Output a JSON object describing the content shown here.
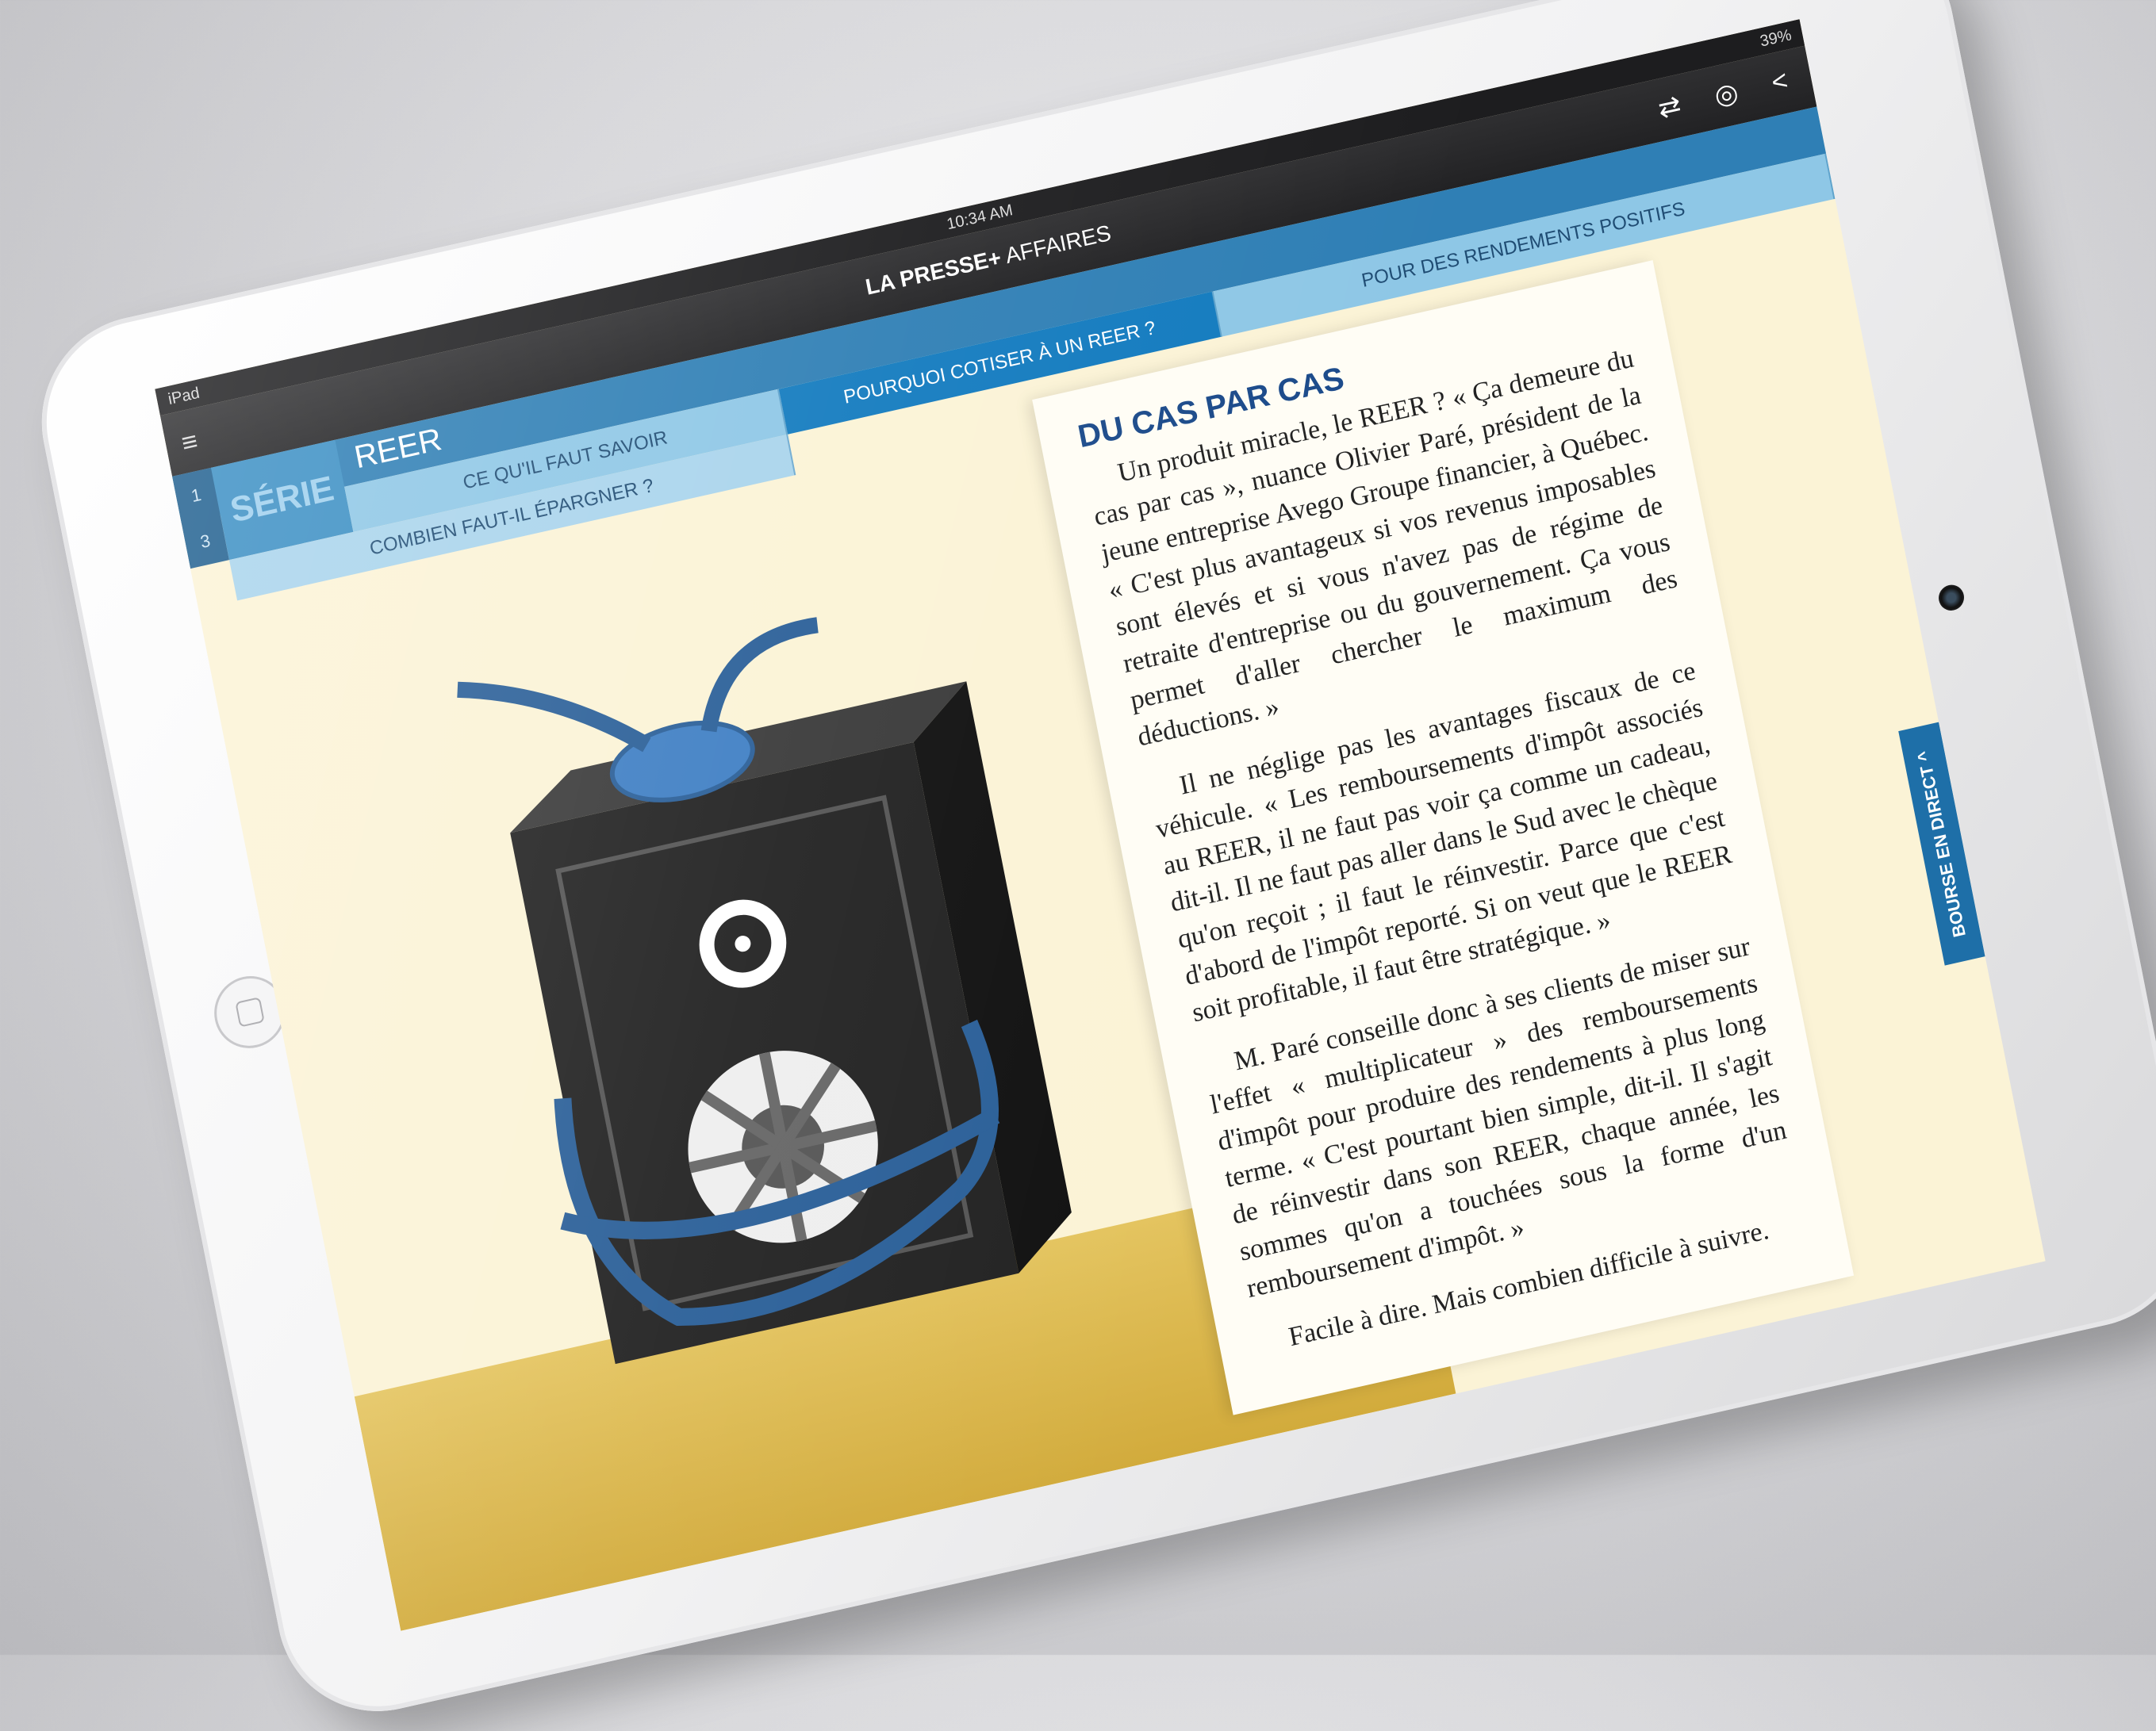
{
  "statusbar": {
    "device": "iPad",
    "time": "10:34 AM",
    "battery": "39%"
  },
  "topbar": {
    "brand_bold": "LA PRESSE+",
    "brand_section": "AFFAIRES",
    "menu_icon": "≡",
    "icons": [
      "refresh-icon",
      "podcast-icon",
      "share-icon"
    ]
  },
  "series": {
    "numbers": [
      "1",
      "3"
    ],
    "label": "SÉRIE",
    "title": "REER"
  },
  "tabs": [
    {
      "label": "CE QU'IL FAUT SAVOIR",
      "active": false
    },
    {
      "label": "POURQUOI COTISER À UN REER ?",
      "active": true
    },
    {
      "label": "POUR DES RENDEMENTS POSITIFS",
      "active": false
    }
  ],
  "subtabs": [
    {
      "label": "COMBIEN FAUT-IL ÉPARGNER ?"
    }
  ],
  "article": {
    "heading": "DU CAS PAR CAS",
    "paragraphs": [
      "Un produit miracle, le REER ? « Ça demeure du cas par cas », nuance Olivier Paré, président de la jeune entreprise Avego Groupe financier, à Québec. « C'est plus avantageux si vos revenus imposables sont élevés et si vous n'avez pas de régime de retraite d'entreprise ou du gouvernement. Ça vous permet d'aller chercher le maximum des déductions. »",
      "Il ne néglige pas les avantages fiscaux de ce véhicule. « Les remboursements d'impôt associés au REER, il ne faut pas voir ça comme un cadeau, dit-il. Il ne faut pas aller dans le Sud avec le chèque qu'on reçoit ; il faut le réinvestir. Parce que c'est d'abord de l'impôt reporté. Si on veut que le REER soit profitable, il faut être stratégique. »",
      "M. Paré conseille donc à ses clients de miser sur l'effet « multiplicateur » des remboursements d'impôt pour produire des rendements à plus long terme. « C'est pourtant bien simple, dit-il. Il s'agit de réinvestir dans son REER, chaque année, les sommes qu'on a touchées sous la forme d'un remboursement d'impôt. »",
      "Facile à dire. Mais combien difficile à suivre."
    ]
  },
  "sidetab": {
    "label": "BOURSE EN DIRECT ^"
  },
  "colors": {
    "header_blue": "#2f7fb5",
    "active_tab": "#137bbf",
    "heading": "#1b4a8a",
    "floor": "#d9b44a"
  }
}
